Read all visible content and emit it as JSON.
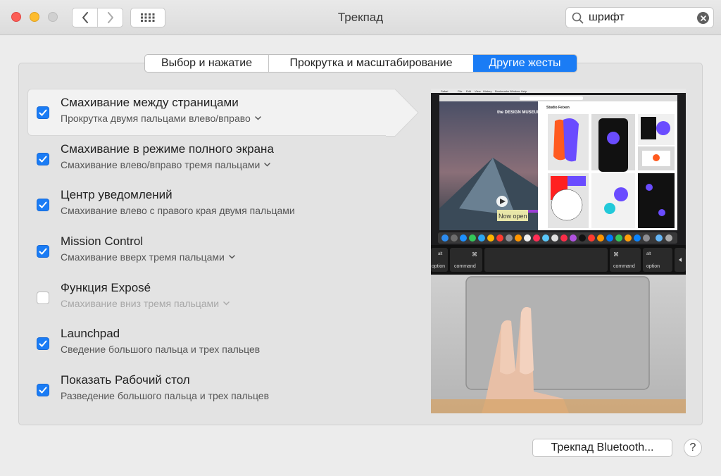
{
  "window": {
    "title": "Трекпад"
  },
  "search": {
    "value": "шрифт"
  },
  "tabs": [
    {
      "label": "Выбор и нажатие",
      "selected": false
    },
    {
      "label": "Прокрутка и масштабирование",
      "selected": false
    },
    {
      "label": "Другие жесты",
      "selected": true
    }
  ],
  "gestures": [
    {
      "title": "Смахивание между страницами",
      "subtitle": "Прокрутка двумя пальцами влево/вправо",
      "checked": true,
      "dropdown": true,
      "selected": true
    },
    {
      "title": "Смахивание в режиме полного экрана",
      "subtitle": "Смахивание влево/вправо тремя пальцами",
      "checked": true,
      "dropdown": true
    },
    {
      "title": "Центр уведомлений",
      "subtitle": "Смахивание влево с правого края двумя пальцами",
      "checked": true,
      "dropdown": false
    },
    {
      "title": "Mission Control",
      "subtitle": "Смахивание вверх тремя пальцами",
      "checked": true,
      "dropdown": true
    },
    {
      "title": "Функция Exposé",
      "subtitle": "Смахивание вниз тремя пальцами",
      "checked": false,
      "dropdown": true
    },
    {
      "title": "Launchpad",
      "subtitle": "Сведение большого пальца и трех пальцев",
      "checked": true,
      "dropdown": false
    },
    {
      "title": "Показать Рабочий стол",
      "subtitle": "Разведение большого пальца и трех пальцев",
      "checked": true,
      "dropdown": false
    }
  ],
  "preview": {
    "screen": {
      "menu_items": [
        "Safari",
        "File",
        "Edit",
        "View",
        "History",
        "Bookmarks",
        "Window",
        "Help"
      ],
      "site_title": "the DESIGN MUSEUM",
      "banner": "Now open",
      "panel_title": "Studio Feixen"
    },
    "keyboard": {
      "left_alt": "alt",
      "left_option": "option",
      "left_cmd_symbol": "⌘",
      "left_cmd": "command",
      "right_cmd_symbol": "⌘",
      "right_cmd": "command",
      "right_alt": "alt",
      "right_option": "option"
    }
  },
  "bottom": {
    "bluetooth_button": "Трекпад Bluetooth...",
    "help_label": "?"
  }
}
